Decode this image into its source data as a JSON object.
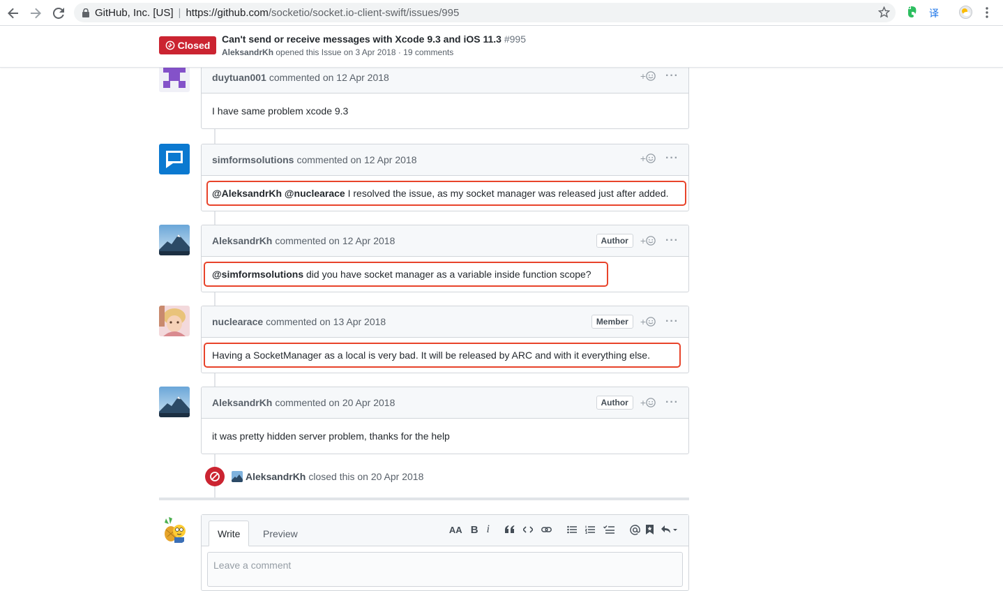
{
  "browser": {
    "site_identity": "GitHub, Inc. [US]",
    "url_host": "https://github.com",
    "url_path": "/socketio/socket.io-client-swift/issues/995",
    "back_icon": "arrow-left-icon",
    "forward_icon": "arrow-right-icon",
    "reload_icon": "reload-icon",
    "extension_translate_glyph": "译"
  },
  "issue": {
    "state": "Closed",
    "title": "Can't send or receive messages with Xcode 9.3 and iOS 11.3",
    "number": "#995",
    "author": "AleksandrKh",
    "meta_rest": "opened this Issue on 3 Apr 2018 · 19 comments",
    "state_color": "#cb2431"
  },
  "comments": [
    {
      "author": "duytuan001",
      "when": "commented on 12 Apr 2018",
      "role": "",
      "mention": "",
      "body": "I have same problem xcode 9.3"
    },
    {
      "author": "simformsolutions",
      "when": "commented on 12 Apr 2018",
      "role": "",
      "mention": "@AleksandrKh @nuclearace",
      "body": " I resolved the issue, as my socket manager was released just after added."
    },
    {
      "author": "AleksandrKh",
      "when": "commented on 12 Apr 2018",
      "role": "Author",
      "mention": "@simformsolutions",
      "body": " did you have socket manager as a variable inside function scope?"
    },
    {
      "author": "nuclearace",
      "when": "commented on 13 Apr 2018",
      "role": "Member",
      "mention": "",
      "body": "Having a SocketManager as a local is very bad. It will be released by ARC and with it everything else."
    },
    {
      "author": "AleksandrKh",
      "when": "commented on 20 Apr 2018",
      "role": "Author",
      "mention": "",
      "body": "it was pretty hidden server problem, thanks for the help"
    }
  ],
  "reaction_label": "+",
  "more_label": "···",
  "closed_event": {
    "author": "AleksandrKh",
    "text": "closed this on 20 Apr 2018"
  },
  "new_comment": {
    "tab_write": "Write",
    "tab_preview": "Preview",
    "placeholder": "Leave a comment",
    "toolbar": {
      "header": "AA",
      "bold": "B",
      "italic": "i"
    }
  },
  "highlight_color": "#e8432a"
}
